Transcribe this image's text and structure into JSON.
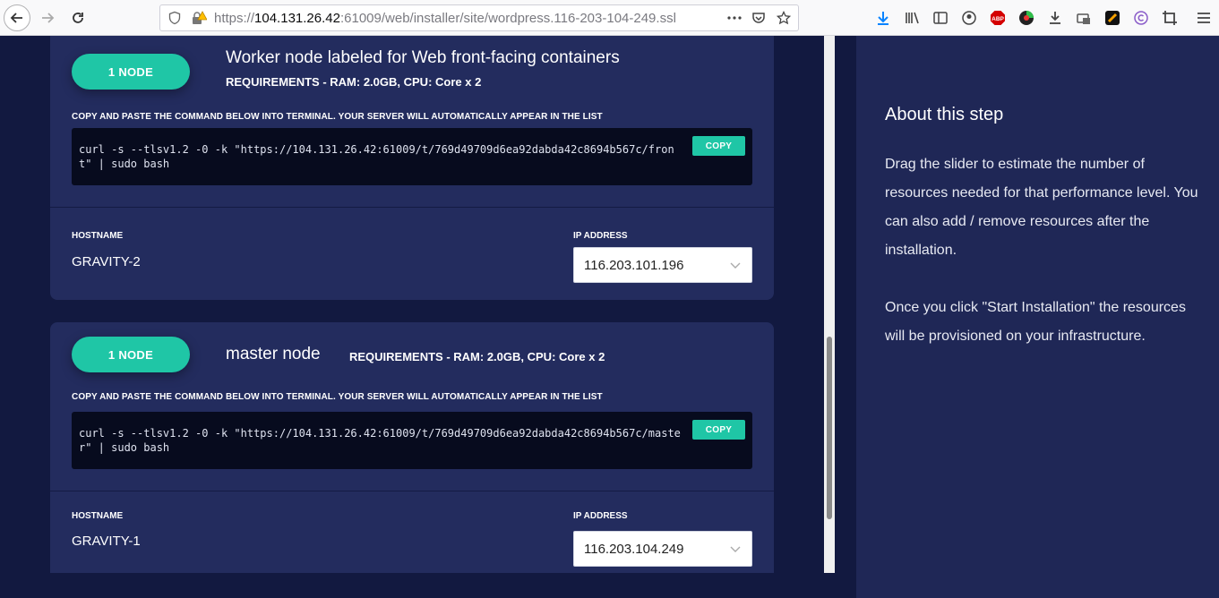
{
  "browser": {
    "url_prefix": "https://",
    "url_host": "104.131.26.42",
    "url_rest": ":61009/web/installer/site/wordpress.116-203-104-249.ssl"
  },
  "nodes": [
    {
      "count_label": "1 NODE",
      "title": "Worker node labeled for Web front-facing containers",
      "requirements": "REQUIREMENTS - RAM: 2.0GB, CPU: Core x 2",
      "instructions": "COPY AND PASTE THE COMMAND BELOW INTO TERMINAL. YOUR SERVER WILL AUTOMATICALLY APPEAR IN THE LIST",
      "command": "curl -s --tlsv1.2 -0 -k \"https://104.131.26.42:61009/t/769d49709d6ea92dabda42c8694b567c/front\" | sudo bash",
      "copy_label": "COPY",
      "hostname_label": "HOSTNAME",
      "hostname": "GRAVITY-2",
      "ip_label": "IP ADDRESS",
      "ip": "116.203.101.196"
    },
    {
      "count_label": "1 NODE",
      "title": "master node",
      "requirements": "REQUIREMENTS - RAM: 2.0GB, CPU: Core x 2",
      "instructions": "COPY AND PASTE THE COMMAND BELOW INTO TERMINAL. YOUR SERVER WILL AUTOMATICALLY APPEAR IN THE LIST",
      "command": "curl -s --tlsv1.2 -0 -k \"https://104.131.26.42:61009/t/769d49709d6ea92dabda42c8694b567c/master\" | sudo bash",
      "copy_label": "COPY",
      "hostname_label": "HOSTNAME",
      "hostname": "GRAVITY-1",
      "ip_label": "IP ADDRESS",
      "ip": "116.203.104.249"
    }
  ],
  "about": {
    "title": "About this step",
    "para1": "Drag the slider to estimate the number of resources needed for that performance level. You can also add / remove resources after the installation.",
    "para2": "Once you click \"Start Installation\" the resources will be provisioned on your infrastructure."
  },
  "colors": {
    "accent": "#1fc6a6",
    "page_bg": "#121940",
    "card_bg": "#232c5e",
    "side_bg": "#1f2756"
  }
}
